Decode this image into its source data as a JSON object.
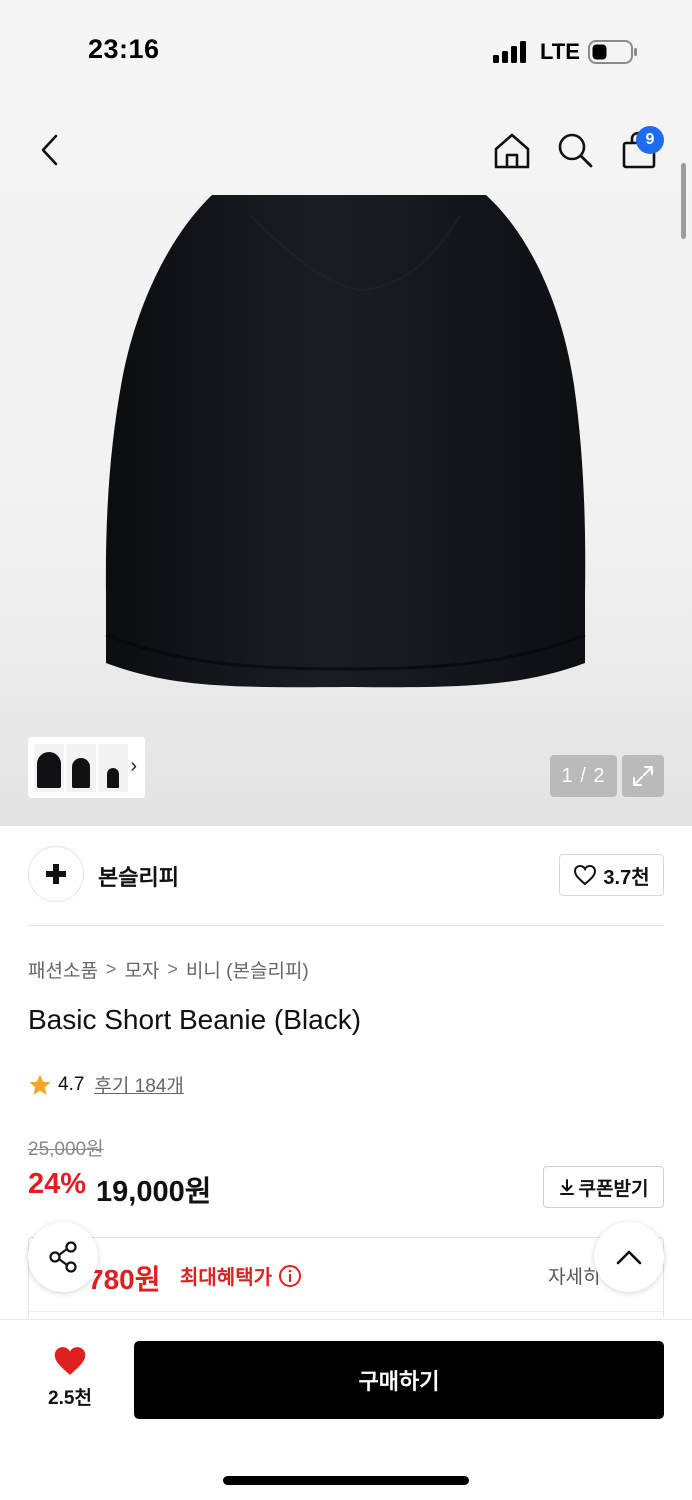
{
  "status_bar": {
    "time": "23:16",
    "network": "LTE"
  },
  "nav": {
    "cart_count": "9"
  },
  "gallery": {
    "counter": "1 / 2",
    "thumb_more": "›"
  },
  "brand": {
    "name": "본슬리피",
    "like_count": "3.7천"
  },
  "breadcrumb": {
    "level1": "패션소품",
    "level2": "모자",
    "level3": "비니 (본슬리피)",
    "separator": ">"
  },
  "product": {
    "title": "Basic Short Beanie (Black)",
    "rating": "4.7",
    "reviews": "후기 184개",
    "original_price": "25,000원",
    "discount": "24%",
    "price": "19,000원",
    "coupon_label": "쿠폰받기"
  },
  "benefit": {
    "price": "780원",
    "label": "최대혜택가",
    "detail": "자세히"
  },
  "bottom": {
    "wish_count": "2.5천",
    "buy_label": "구매하기"
  },
  "colors": {
    "accent_red": "#e02020",
    "badge_blue": "#1f6bf0",
    "buy_button": "#000000",
    "star": "#f5a623"
  }
}
